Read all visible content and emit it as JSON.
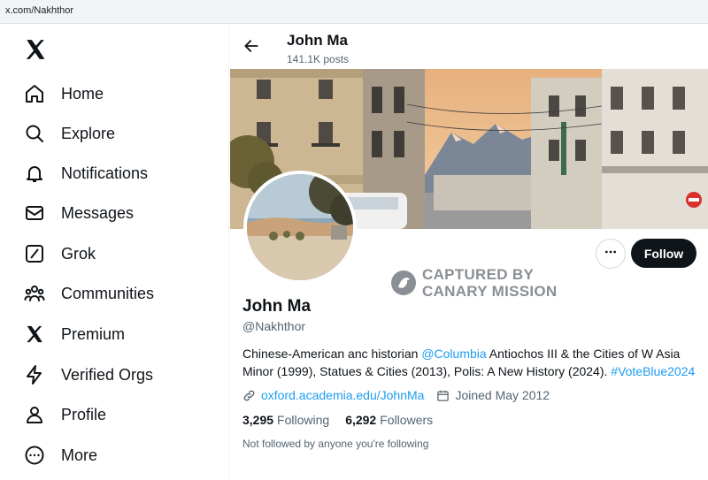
{
  "browser": {
    "url": "x.com/Nakhthor"
  },
  "sidebar": {
    "items": [
      {
        "label": "Home",
        "icon": "home-icon"
      },
      {
        "label": "Explore",
        "icon": "search-icon"
      },
      {
        "label": "Notifications",
        "icon": "bell-icon"
      },
      {
        "label": "Messages",
        "icon": "envelope-icon"
      },
      {
        "label": "Grok",
        "icon": "grok-icon"
      },
      {
        "label": "Communities",
        "icon": "people-icon"
      },
      {
        "label": "Premium",
        "icon": "x-logo-icon"
      },
      {
        "label": "Verified Orgs",
        "icon": "lightning-icon"
      },
      {
        "label": "Profile",
        "icon": "person-icon"
      },
      {
        "label": "More",
        "icon": "more-circle-icon"
      }
    ]
  },
  "header": {
    "name": "John Ma",
    "posts": "141.1K posts"
  },
  "profile": {
    "follow_label": "Follow",
    "name": "John Ma",
    "handle": "@Nakhthor",
    "bio": {
      "part1": "Chinese-American anc historian ",
      "mention": "@Columbia",
      "part2": " Antiochos III & the Cities of W Asia Minor (1999), Statues & Cities (2013), Polis: A New History (2024). ",
      "hashtag": "#VoteBlue2024"
    },
    "website": "oxford.academia.edu/JohnMa",
    "joined": "Joined May 2012",
    "following_count": "3,295",
    "following_label": "Following",
    "followers_count": "6,292",
    "followers_label": "Followers",
    "followed_note": "Not followed by anyone you're following"
  },
  "watermark": {
    "line1": "CAPTURED BY",
    "line2": "CANARY MISSION"
  },
  "colors": {
    "link": "#1d9bf0",
    "text": "#0f1419",
    "muted": "#536471",
    "button": "#0f1419"
  }
}
